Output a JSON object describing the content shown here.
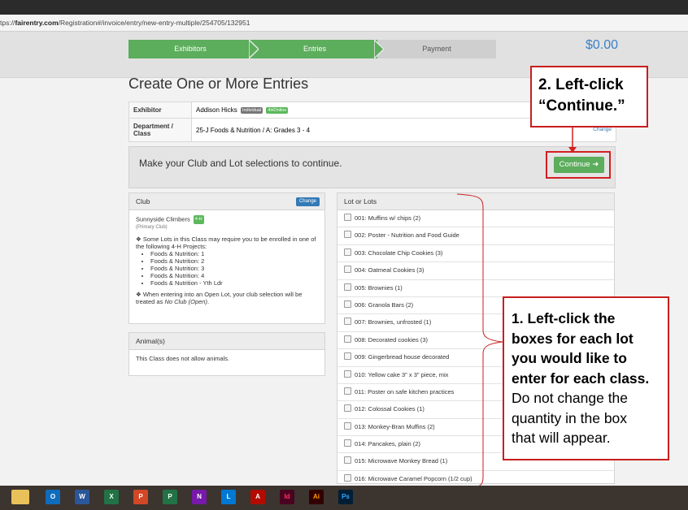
{
  "browser": {
    "url_prefix": "tps://",
    "url_domain": "fairentry.com",
    "url_path": "/Registration#/invoice/entry/new-entry-multiple/254705/132951"
  },
  "steps": [
    "Exhibitors",
    "Entries",
    "Payment"
  ],
  "total": "$0.00",
  "page_title": "Create One or More Entries",
  "exhibitor": {
    "label": "Exhibitor",
    "name": "Addison Hicks",
    "badge1": "Individual",
    "badge2": "4HOnline"
  },
  "department": {
    "label": "Department / Class",
    "value": "25-J Foods & Nutrition  /  A: Grades 3 - 4",
    "change": "Change"
  },
  "notice": {
    "text": "Make your Club and Lot selections to continue.",
    "button": "Continue ➜"
  },
  "club": {
    "header": "Club",
    "change": "Change",
    "name": "Sunnyside Climbers",
    "badge": "4-H",
    "sub": "(Primary Club)",
    "info": "Some Lots in this Class may require you to be enrolled in one of the following 4-H Projects:",
    "projects": [
      "Foods & Nutrition: 1",
      "Foods & Nutrition: 2",
      "Foods & Nutrition: 3",
      "Foods & Nutrition: 4",
      "Foods & Nutrition - Yth Ldr"
    ],
    "open_note_a": "When entering into an Open Lot, your club selection will be treated as ",
    "open_note_b": "No Club (Open)",
    "open_note_c": "."
  },
  "animals": {
    "header": "Animal(s)",
    "text": "This Class does not allow animals."
  },
  "lots": {
    "header": "Lot or Lots",
    "items": [
      "001: Muffins w/ chips (2)",
      "002: Poster - Nutrition and Food Guide",
      "003: Chocolate Chip Cookies (3)",
      "004: Oatmeal Cookies (3)",
      "005: Brownies (1)",
      "006: Granola Bars (2)",
      "007: Brownies, unfrosted (1)",
      "008: Decorated cookies (3)",
      "009: Gingerbread house decorated",
      "010: Yellow cake 3\" x 3\" piece, mix",
      "011: Poster on safe kitchen practices",
      "012: Colossal Cookies (1)",
      "013: Monkey-Bran Muffins (2)",
      "014: Pancakes, plain (2)",
      "015: Microwave Monkey Bread (1)",
      "016: Microwave Caramel Popcorn (1/2 cup)"
    ]
  },
  "callout2": {
    "line1": "2. Left-click",
    "line2": "“Continue.”"
  },
  "callout1": {
    "l1": "1. Left-click the",
    "l2": "boxes for each lot",
    "l3": "you would like to",
    "l4": "enter for each class.",
    "l5": "Do not change the",
    "l6": "quantity in the box",
    "l7": "that will appear."
  },
  "taskbar": {
    "apps": [
      "O",
      "W",
      "X",
      "P",
      "P",
      "N",
      "L",
      "A",
      "Id",
      "Ai",
      "Ps"
    ]
  },
  "colors": {
    "accent_green": "#5cad5c",
    "annotation_red": "#d32020",
    "total_blue": "#3b80c6"
  }
}
